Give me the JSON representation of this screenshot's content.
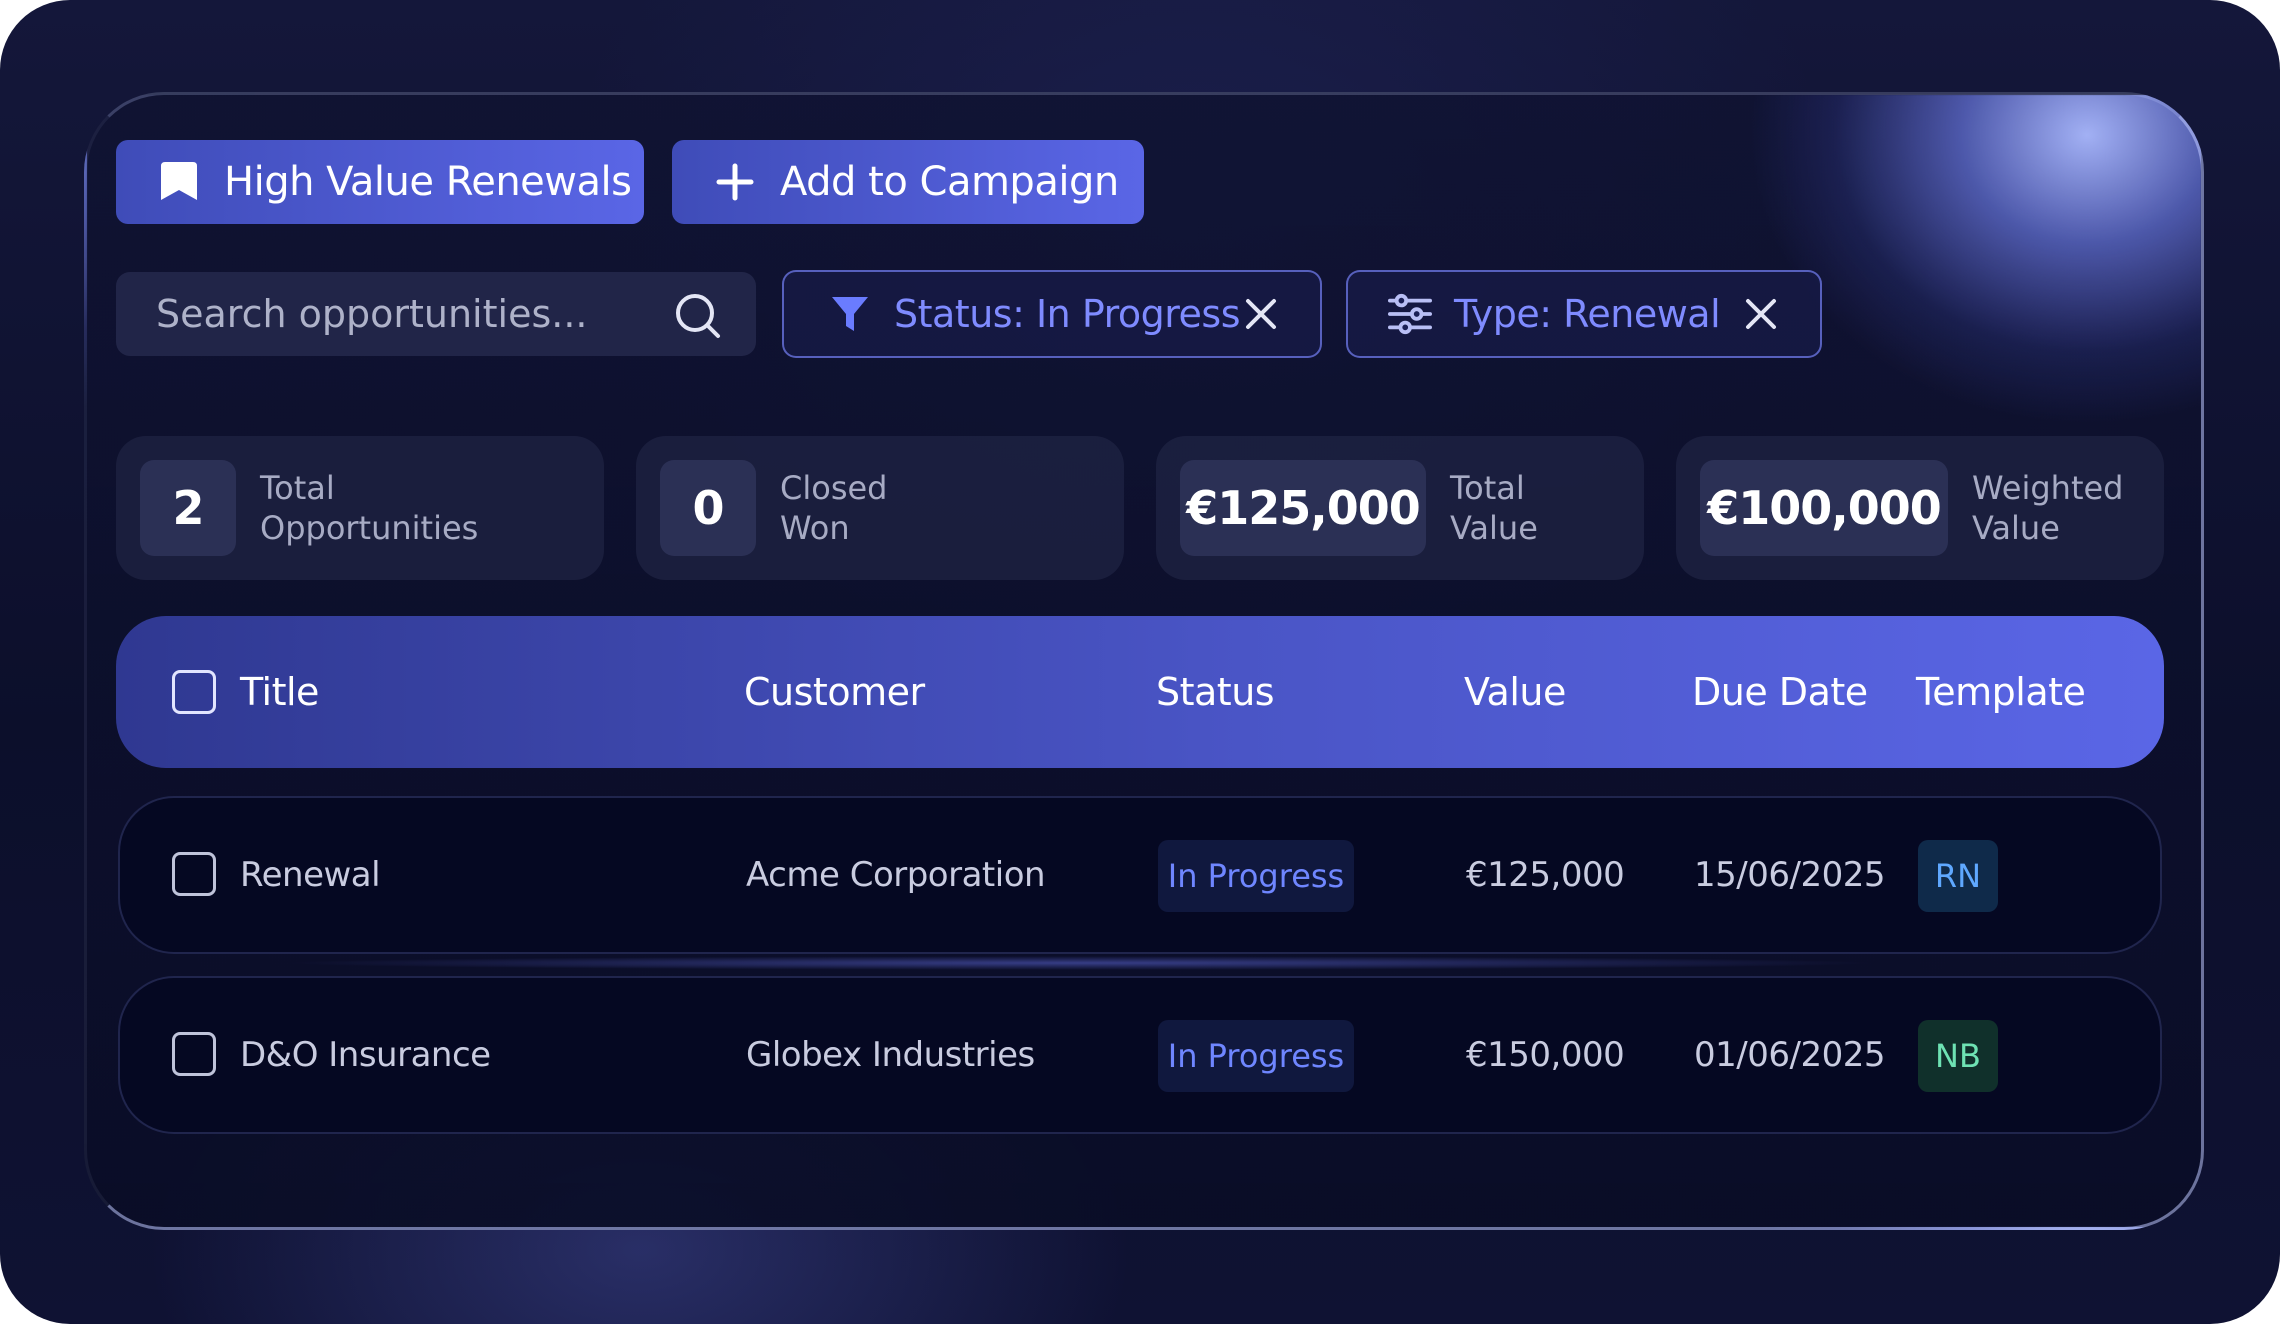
{
  "toolbar": {
    "saved_view_label": "High Value Renewals",
    "add_campaign_label": "Add to Campaign"
  },
  "search": {
    "placeholder": "Search opportunities..."
  },
  "filters": [
    {
      "label": "Status: In Progress",
      "icon": "funnel-icon"
    },
    {
      "label": "Type: Renewal",
      "icon": "sliders-icon"
    }
  ],
  "stats": [
    {
      "value": "2",
      "label_line1": "Total",
      "label_line2": "Opportunities"
    },
    {
      "value": "0",
      "label_line1": "Closed",
      "label_line2": "Won"
    },
    {
      "value": "€125,000",
      "label_line1": "Total",
      "label_line2": "Value"
    },
    {
      "value": "€100,000",
      "label_line1": "Weighted",
      "label_line2": "Value"
    }
  ],
  "table": {
    "columns": [
      "Title",
      "Customer",
      "Status",
      "Value",
      "Due Date",
      "Template"
    ],
    "rows": [
      {
        "title": "Renewal",
        "customer": "Acme Corporation",
        "status": "In Progress",
        "value": "€125,000",
        "due_date": "15/06/2025",
        "template": "RN"
      },
      {
        "title": "D&O Insurance",
        "customer": "Globex Industries",
        "status": "In Progress",
        "value": "€150,000",
        "due_date": "01/06/2025",
        "template": "NB"
      }
    ]
  },
  "colors": {
    "accent": "#5a66e6",
    "background": "#0c0f2b",
    "status_text": "#6f86ff",
    "template_rn": "#5fa8ff",
    "template_nb": "#6ee2b3"
  }
}
